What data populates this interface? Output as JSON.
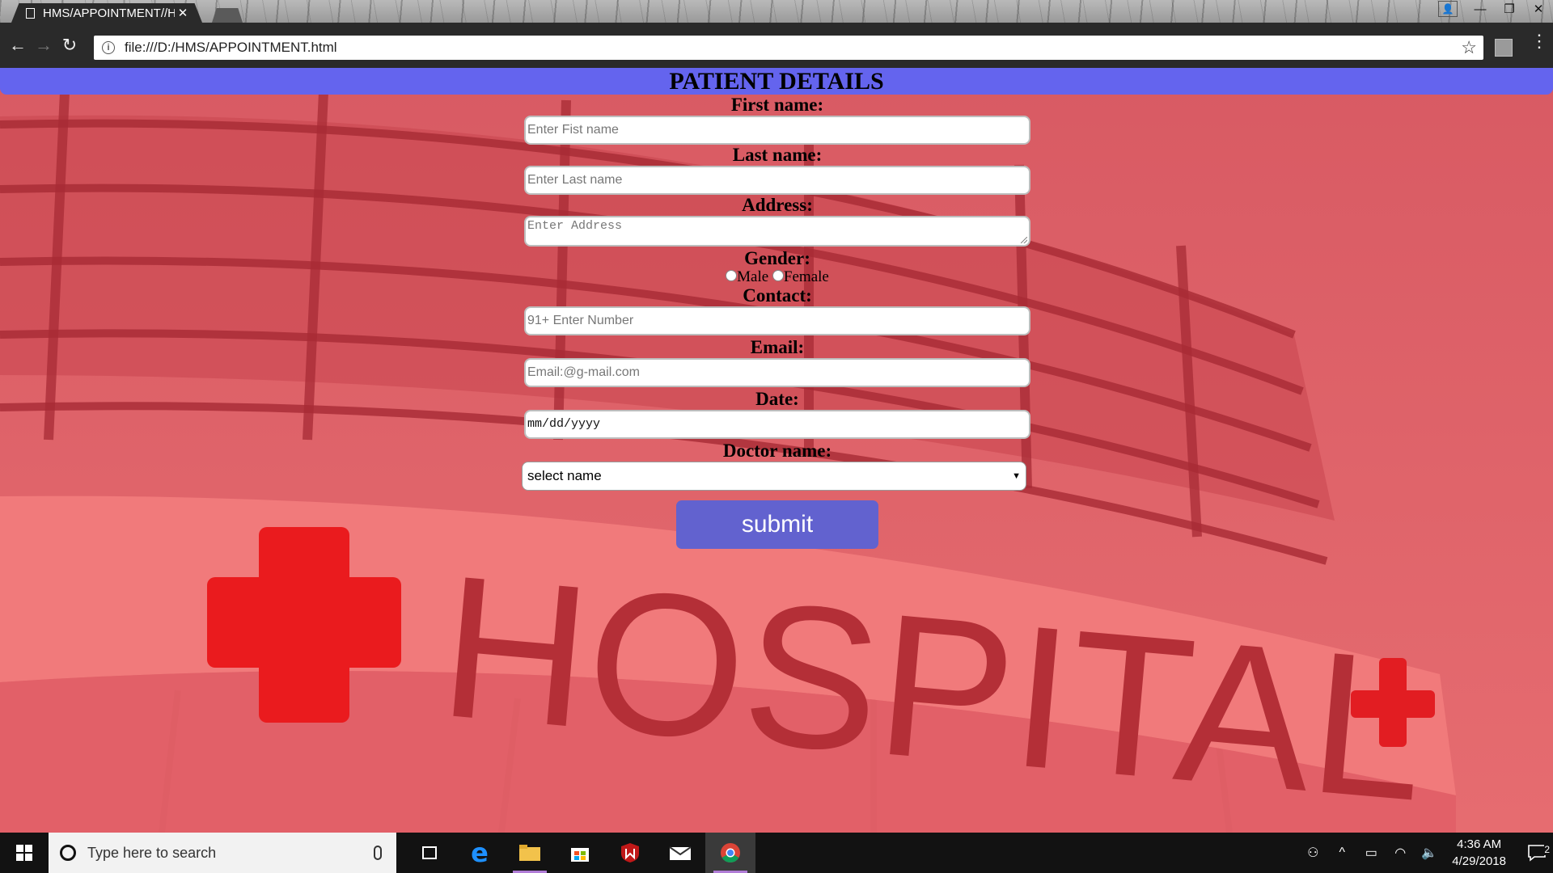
{
  "browser": {
    "tab_title": "HMS/APPOINTMENT//H",
    "url": "file:///D:/HMS/APPOINTMENT.html"
  },
  "page": {
    "banner": "PATIENT DETAILS",
    "background_text": "HOSPITAL",
    "form": {
      "first_name_label": "First name:",
      "first_name_placeholder": "Enter Fist name",
      "last_name_label": "Last name:",
      "last_name_placeholder": "Enter Last name",
      "address_label": "Address:",
      "address_placeholder": "Enter Address",
      "gender_label": "Gender:",
      "gender_male": "Male",
      "gender_female": "Female",
      "contact_label": "Contact:",
      "contact_placeholder": "91+ Enter Number",
      "email_label": "Email:",
      "email_placeholder": "Email:@g-mail.com",
      "date_label": "Date:",
      "date_value": "mm/dd/yyyy",
      "doctor_label": "Doctor name:",
      "doctor_selected": "select name",
      "submit_label": "submit"
    }
  },
  "taskbar": {
    "search_placeholder": "Type here to search",
    "time": "4:36 AM",
    "date": "4/29/2018",
    "notification_count": "2"
  },
  "colors": {
    "banner": "#6464ee",
    "submit": "#6262cf",
    "page_tint": "#e46a6f"
  }
}
